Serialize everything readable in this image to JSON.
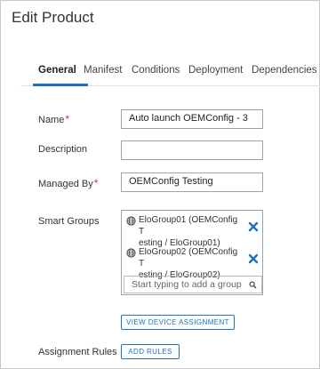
{
  "page": {
    "title": "Edit Product"
  },
  "tabs": [
    {
      "label": "General"
    },
    {
      "label": "Manifest"
    },
    {
      "label": "Conditions"
    },
    {
      "label": "Deployment"
    },
    {
      "label": "Dependencies"
    }
  ],
  "form": {
    "name": {
      "label": "Name",
      "value": "Auto launch OEMConfig - 3"
    },
    "description": {
      "label": "Description",
      "value": ""
    },
    "managed_by": {
      "label": "Managed By",
      "value": "OEMConfig Testing"
    },
    "smart_groups": {
      "label": "Smart Groups",
      "items": [
        {
          "line1": "EloGroup01 (OEMConfig T",
          "line2": "esting  / EloGroup01)"
        },
        {
          "line1": "EloGroup02 (OEMConfig T",
          "line2": "esting  / EloGroup02)"
        }
      ],
      "placeholder": "Start typing to add a group"
    },
    "assignment_rules": {
      "label": "Assignment Rules"
    }
  },
  "buttons": {
    "view_device_assignment": "VIEW DEVICE ASSIGNMENT",
    "add_rules": "ADD RULES"
  },
  "colors": {
    "accent": "#1b72bd",
    "required": "#d0312d"
  }
}
